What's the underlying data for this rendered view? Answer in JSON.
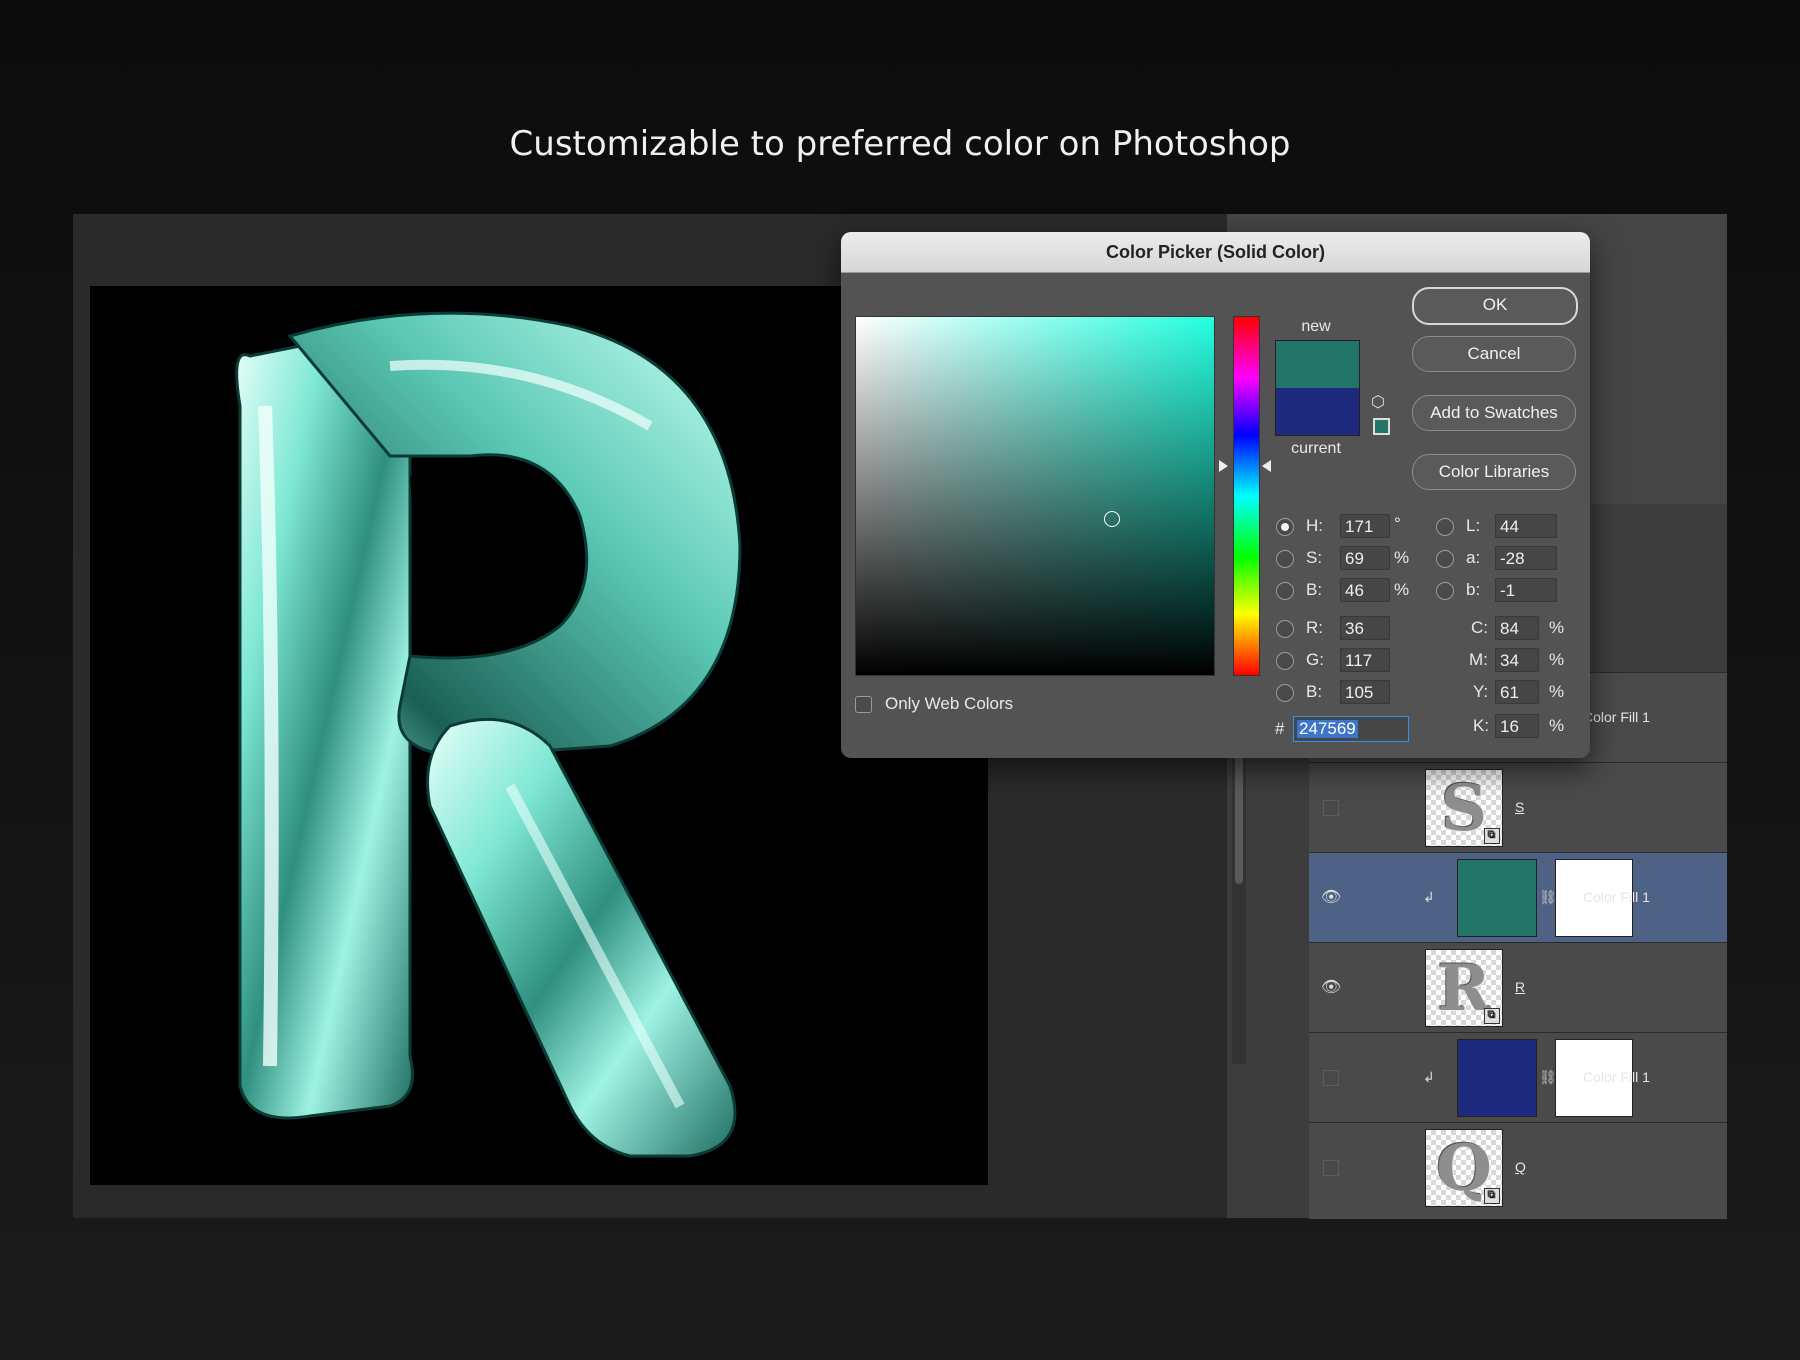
{
  "headline": "Customizable to preferred color on Photoshop",
  "dialog": {
    "title": "Color Picker (Solid Color)",
    "new_label": "new",
    "current_label": "current",
    "new_color": "#247569",
    "current_color": "#1e2a7e",
    "buttons": {
      "ok": "OK",
      "cancel": "Cancel",
      "add_swatches": "Add to Swatches",
      "color_libraries": "Color Libraries"
    },
    "only_web_colors": "Only Web Colors",
    "hsb": {
      "h_label": "H:",
      "h": "171",
      "h_unit": "°",
      "s_label": "S:",
      "s": "69",
      "s_unit": "%",
      "b_label": "B:",
      "b": "46",
      "b_unit": "%"
    },
    "rgb": {
      "r_label": "R:",
      "r": "36",
      "g_label": "G:",
      "g": "117",
      "b_label": "B:",
      "b": "105"
    },
    "lab": {
      "l_label": "L:",
      "l": "44",
      "a_label": "a:",
      "a": "-28",
      "b_label": "b:",
      "b": "-1"
    },
    "cmyk": {
      "c_label": "C:",
      "c": "84",
      "m_label": "M:",
      "m": "34",
      "y_label": "Y:",
      "y": "61",
      "k_label": "K:",
      "k": "16",
      "unit": "%"
    },
    "hex_label": "#",
    "hex": "247569",
    "selected_mode": "H"
  },
  "layers": [
    {
      "name": "Color Fill 1",
      "type": "fill-partial",
      "visible": false
    },
    {
      "name": "S",
      "type": "smart",
      "letter": "S",
      "visible": false
    },
    {
      "name": "Color Fill 1",
      "type": "fill",
      "color": "#247569",
      "visible": true,
      "selected": true
    },
    {
      "name": "R",
      "type": "smart",
      "letter": "R",
      "visible": true
    },
    {
      "name": "Color Fill 1",
      "type": "fill",
      "color": "#1e2a7e",
      "visible": false
    },
    {
      "name": "Q",
      "type": "smart",
      "letter": "Q",
      "visible": false
    }
  ],
  "canvas": {
    "letter": "R",
    "balloon_color": "#7fe8d4"
  }
}
